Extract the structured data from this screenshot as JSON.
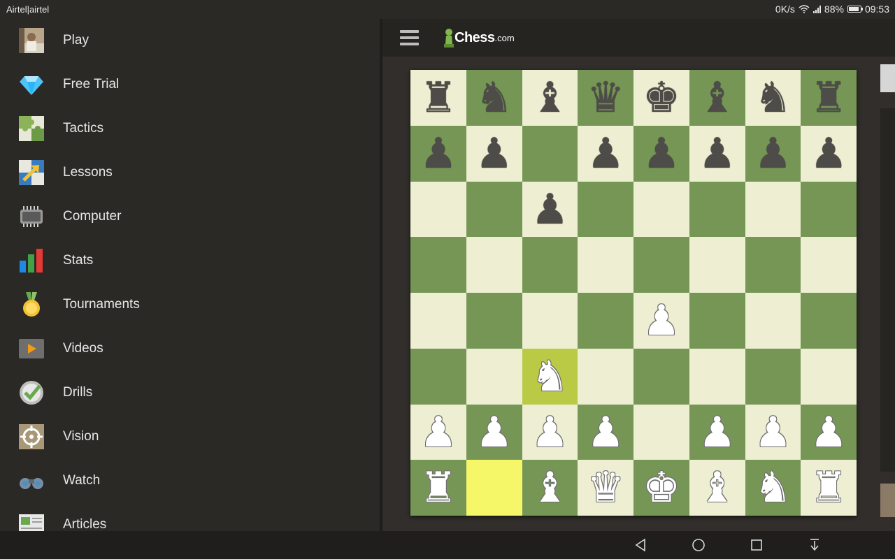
{
  "status_bar": {
    "carrier": "Airtel|airtel",
    "speed": "0K/s",
    "battery": "88%",
    "battery_level": 0.88,
    "time": "09:53"
  },
  "sidebar": {
    "items": [
      {
        "label": "Play",
        "icon": "avatar-icon"
      },
      {
        "label": "Free Trial",
        "icon": "diamond-icon"
      },
      {
        "label": "Tactics",
        "icon": "puzzle-icon"
      },
      {
        "label": "Lessons",
        "icon": "lessons-arrow-icon"
      },
      {
        "label": "Computer",
        "icon": "chip-icon"
      },
      {
        "label": "Stats",
        "icon": "bar-chart-icon"
      },
      {
        "label": "Tournaments",
        "icon": "medal-icon"
      },
      {
        "label": "Videos",
        "icon": "play-video-icon"
      },
      {
        "label": "Drills",
        "icon": "checkmark-icon"
      },
      {
        "label": "Vision",
        "icon": "crosshair-icon"
      },
      {
        "label": "Watch",
        "icon": "binoculars-icon"
      },
      {
        "label": "Articles",
        "icon": "newspaper-icon"
      }
    ]
  },
  "header": {
    "logo_text": "Chess",
    "logo_suffix": ".com",
    "menu_icon": "hamburger-icon"
  },
  "board": {
    "light_color": "#eeeed2",
    "dark_color": "#769656",
    "highlight_from": "b1",
    "highlight_to": "c3",
    "position": [
      [
        "br",
        "bn",
        "bb",
        "bq",
        "bk",
        "bb",
        "bn",
        "br"
      ],
      [
        "bp",
        "bp",
        "",
        "bp",
        "bp",
        "bp",
        "bp",
        "bp"
      ],
      [
        "",
        "",
        "bp",
        "",
        "",
        "",
        "",
        ""
      ],
      [
        "",
        "",
        "",
        "",
        "",
        "",
        "",
        ""
      ],
      [
        "",
        "",
        "",
        "",
        "wp",
        "",
        "",
        ""
      ],
      [
        "",
        "",
        "wn",
        "",
        "",
        "",
        "",
        ""
      ],
      [
        "wp",
        "wp",
        "wp",
        "wp",
        "",
        "wp",
        "wp",
        "wp"
      ],
      [
        "wr",
        "",
        "wb",
        "wq",
        "wk",
        "wb",
        "wn",
        "wr"
      ]
    ]
  },
  "android_nav": {
    "back": "back-icon",
    "home": "home-icon",
    "recents": "recents-icon",
    "notifications": "notification-pull-icon"
  }
}
